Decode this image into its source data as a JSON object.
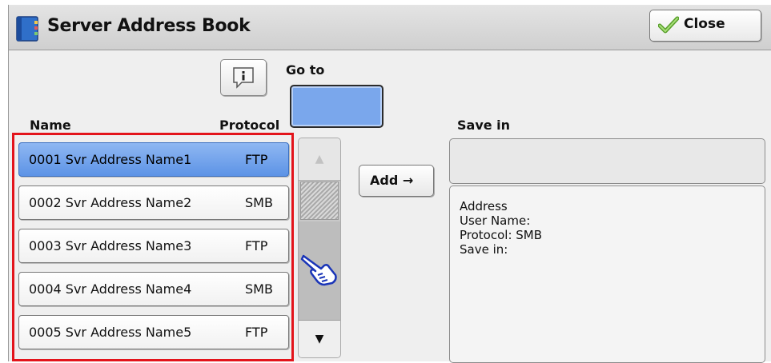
{
  "window": {
    "title": "Server Address Book",
    "close_label": "Close"
  },
  "goto": {
    "label": "Go to",
    "value": ""
  },
  "columns": {
    "name": "Name",
    "protocol": "Protocol",
    "save_in": "Save in"
  },
  "rows": [
    {
      "text": "0001  Svr Address Name1",
      "protocol": "FTP",
      "selected": true
    },
    {
      "text": "0002  Svr Address Name2",
      "protocol": "SMB",
      "selected": false
    },
    {
      "text": "0003  Svr Address Name3",
      "protocol": "FTP",
      "selected": false
    },
    {
      "text": "0004  Svr Address Name4",
      "protocol": "SMB",
      "selected": false
    },
    {
      "text": "0005  Svr Address Name5",
      "protocol": "FTP",
      "selected": false
    }
  ],
  "add_button": {
    "label": "Add →"
  },
  "save_in_field": {
    "value": ""
  },
  "details": {
    "address": "Address",
    "user_name": "User Name:",
    "protocol": "Protocol: SMB",
    "save_in": "Save in:"
  },
  "icons": {
    "title": "address-book-icon",
    "close": "checkmark-icon",
    "info": "info-icon",
    "scroll_up": "arrow-up-icon",
    "scroll_down": "arrow-down-icon",
    "pointer": "pointing-hand-icon"
  },
  "colors": {
    "selected_row": "#5c93e6",
    "goto_field": "#7aa7ec",
    "highlight_outline": "#e3141b"
  }
}
